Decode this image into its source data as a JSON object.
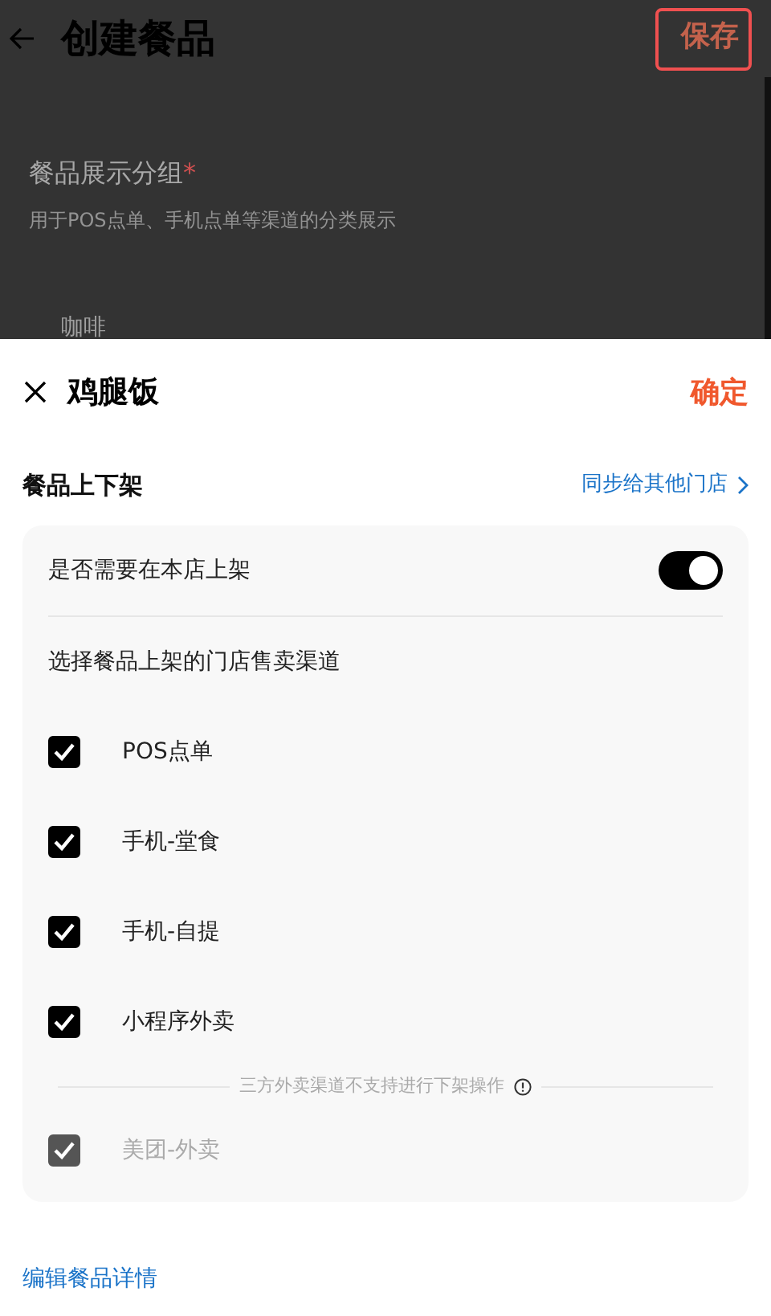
{
  "back_page": {
    "title": "创建餐品",
    "save": {
      "label": "保存",
      "highlighted": true
    },
    "field_label": "餐品展示分组",
    "required_mark": "*",
    "field_hint": "用于POS点单、手机点单等渠道的分类展示",
    "option": "咖啡"
  },
  "sheet": {
    "title": "鸡腿饭",
    "confirm": "确定",
    "section_title": "餐品上下架",
    "sync_link": "同步给其他门店",
    "listing_toggle": {
      "label": "是否需要在本店上架",
      "on": true
    },
    "channels_heading": "选择餐品上架的门店售卖渠道",
    "channels": [
      {
        "kind": "checkbox",
        "label": "POS点单",
        "checked": true,
        "disabled": false
      },
      {
        "kind": "checkbox",
        "label": "手机-堂食",
        "checked": true,
        "disabled": false
      },
      {
        "kind": "checkbox",
        "label": "手机-自提",
        "checked": true,
        "disabled": false
      },
      {
        "kind": "checkbox",
        "label": "小程序外卖",
        "checked": true,
        "disabled": false
      },
      {
        "kind": "note",
        "label": "三方外卖渠道不支持进行下架操作"
      },
      {
        "kind": "checkbox",
        "label": "美团-外卖",
        "checked": true,
        "disabled": true
      }
    ],
    "edit_link": "编辑餐品详情"
  }
}
